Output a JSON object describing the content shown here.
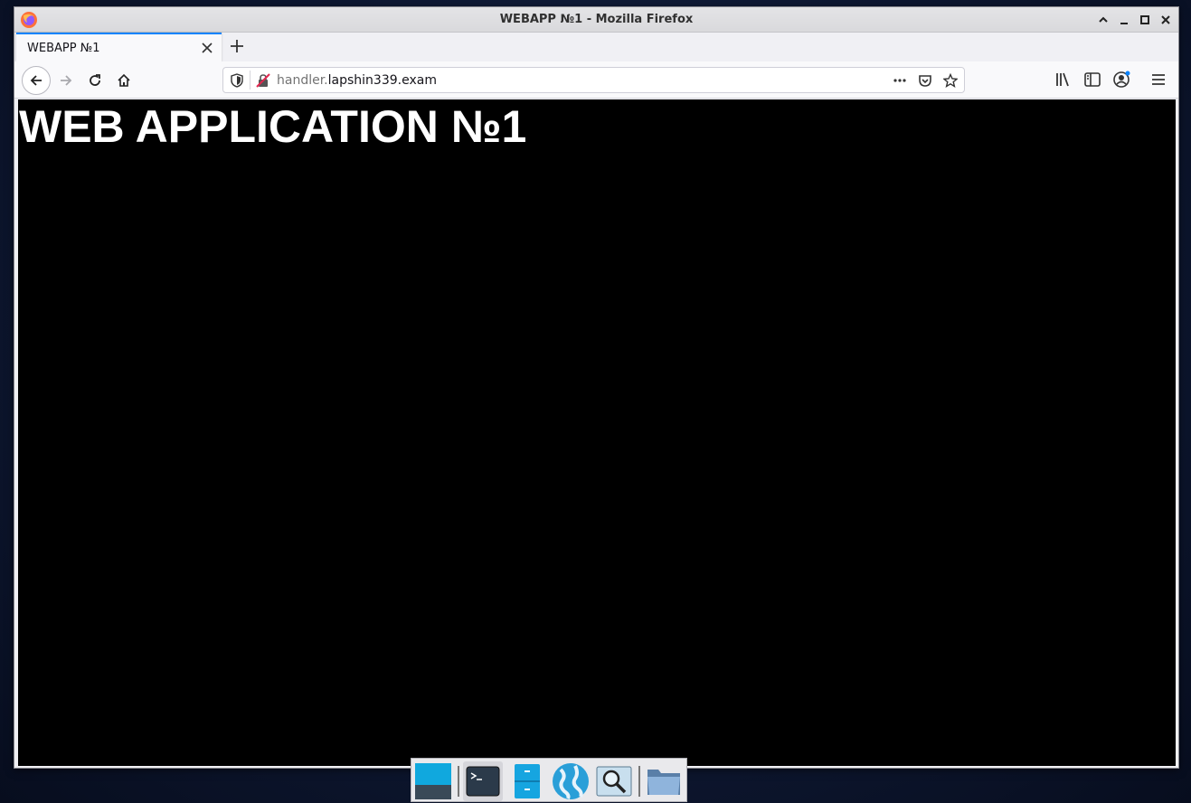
{
  "window": {
    "title": "WEBAPP №1 - Mozilla Firefox"
  },
  "tabs": [
    {
      "label": "WEBAPP №1",
      "active": true
    }
  ],
  "navbar": {
    "url_prefix": "handler.",
    "url_domain": "lapshin339.exam"
  },
  "page": {
    "heading": "WEB APPLICATION №1",
    "background": "#000000",
    "text_color": "#ffffff"
  },
  "icons": {
    "titlebar": [
      "firefox-icon",
      "chevron-up-icon",
      "minimize-icon",
      "maximize-icon",
      "close-icon"
    ],
    "navbar": [
      "back-arrow-icon",
      "forward-arrow-icon",
      "reload-icon",
      "home-icon",
      "shield-icon",
      "insecure-lock-icon",
      "more-dots-icon",
      "pocket-icon",
      "bookmark-star-icon",
      "library-icon",
      "sidebar-icon",
      "account-icon",
      "hamburger-menu-icon"
    ],
    "dock": [
      "show-desktop-icon",
      "terminal-icon",
      "file-manager-icon",
      "web-browser-icon",
      "search-icon",
      "folder-icon"
    ]
  },
  "colors": {
    "accent": "#0a84ff",
    "insecure": "#e22850"
  }
}
